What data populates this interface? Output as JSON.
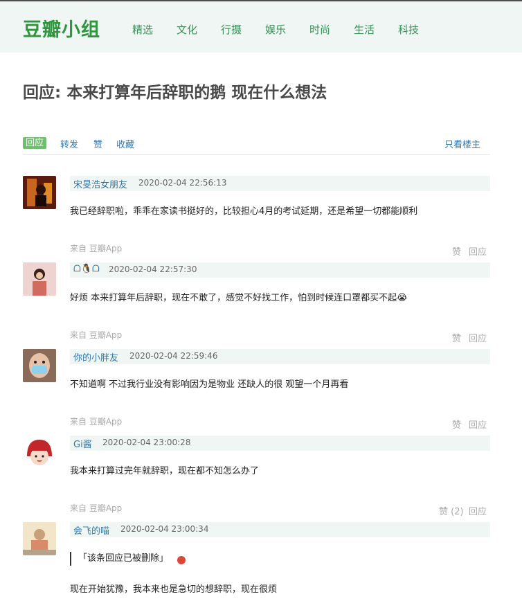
{
  "header": {
    "logo": "豆瓣小组",
    "nav": [
      "精选",
      "文化",
      "行摄",
      "娱乐",
      "时尚",
      "生活",
      "科技"
    ]
  },
  "page_title": "回应: 本来打算年后辞职的鹅 现在什么想法",
  "actions": {
    "reply": "回应",
    "forward": "转发",
    "like": "赞",
    "collect": "收藏",
    "only_op": "只看楼主"
  },
  "replies": [
    {
      "author": "宋旻浩女朋友",
      "time": "2020-02-04 22:56:13",
      "content": "我已经辞职啦，乖乖在家读书挺好的，比较担心4月的考试延期，还是希望一切都能顺利",
      "source": "来自 豆瓣App",
      "like": "赞",
      "reply": "回应"
    },
    {
      "author": "ᗝ🐧ᗝ",
      "time": "2020-02-04 22:57:30",
      "content": "好烦 本来打算年后辞职，现在不敢了，感觉不好找工作，怕到时候连口罩都买不起😭",
      "source": "来自 豆瓣App",
      "like": "赞",
      "reply": "回应"
    },
    {
      "author": "你的小胖友",
      "time": "2020-02-04 22:59:46",
      "content": "不知道啊 不过我行业没有影响因为是物业 还缺人的很 观望一个月再看",
      "source": "来自 豆瓣App",
      "like": "赞",
      "reply": "回应"
    },
    {
      "author": "Gi酱",
      "time": "2020-02-04 23:00:28",
      "content": "我本来打算过完年就辞职，现在都不知怎么办了",
      "source": "来自 豆瓣App",
      "like": "赞 (2)",
      "reply": "回应"
    },
    {
      "author": "会飞的喵",
      "time": "2020-02-04 23:00:34",
      "quote": "「该条回应已被删除」",
      "content": "现在开始犹豫，我本来也是急切的想辞职，现在很烦"
    }
  ]
}
